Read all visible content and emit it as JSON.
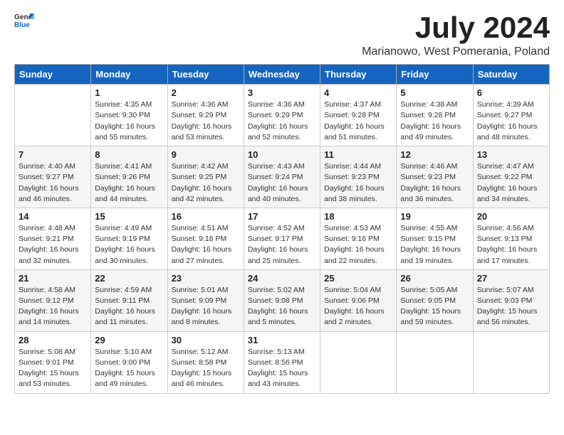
{
  "header": {
    "logo_general": "General",
    "logo_blue": "Blue",
    "month_title": "July 2024",
    "subtitle": "Marianowo, West Pomerania, Poland"
  },
  "days_of_week": [
    "Sunday",
    "Monday",
    "Tuesday",
    "Wednesday",
    "Thursday",
    "Friday",
    "Saturday"
  ],
  "weeks": [
    [
      {
        "day": "",
        "info": ""
      },
      {
        "day": "1",
        "info": "Sunrise: 4:35 AM\nSunset: 9:30 PM\nDaylight: 16 hours\nand 55 minutes."
      },
      {
        "day": "2",
        "info": "Sunrise: 4:36 AM\nSunset: 9:29 PM\nDaylight: 16 hours\nand 53 minutes."
      },
      {
        "day": "3",
        "info": "Sunrise: 4:36 AM\nSunset: 9:29 PM\nDaylight: 16 hours\nand 52 minutes."
      },
      {
        "day": "4",
        "info": "Sunrise: 4:37 AM\nSunset: 9:28 PM\nDaylight: 16 hours\nand 51 minutes."
      },
      {
        "day": "5",
        "info": "Sunrise: 4:38 AM\nSunset: 9:28 PM\nDaylight: 16 hours\nand 49 minutes."
      },
      {
        "day": "6",
        "info": "Sunrise: 4:39 AM\nSunset: 9:27 PM\nDaylight: 16 hours\nand 48 minutes."
      }
    ],
    [
      {
        "day": "7",
        "info": "Sunrise: 4:40 AM\nSunset: 9:27 PM\nDaylight: 16 hours\nand 46 minutes."
      },
      {
        "day": "8",
        "info": "Sunrise: 4:41 AM\nSunset: 9:26 PM\nDaylight: 16 hours\nand 44 minutes."
      },
      {
        "day": "9",
        "info": "Sunrise: 4:42 AM\nSunset: 9:25 PM\nDaylight: 16 hours\nand 42 minutes."
      },
      {
        "day": "10",
        "info": "Sunrise: 4:43 AM\nSunset: 9:24 PM\nDaylight: 16 hours\nand 40 minutes."
      },
      {
        "day": "11",
        "info": "Sunrise: 4:44 AM\nSunset: 9:23 PM\nDaylight: 16 hours\nand 38 minutes."
      },
      {
        "day": "12",
        "info": "Sunrise: 4:46 AM\nSunset: 9:23 PM\nDaylight: 16 hours\nand 36 minutes."
      },
      {
        "day": "13",
        "info": "Sunrise: 4:47 AM\nSunset: 9:22 PM\nDaylight: 16 hours\nand 34 minutes."
      }
    ],
    [
      {
        "day": "14",
        "info": "Sunrise: 4:48 AM\nSunset: 9:21 PM\nDaylight: 16 hours\nand 32 minutes."
      },
      {
        "day": "15",
        "info": "Sunrise: 4:49 AM\nSunset: 9:19 PM\nDaylight: 16 hours\nand 30 minutes."
      },
      {
        "day": "16",
        "info": "Sunrise: 4:51 AM\nSunset: 9:18 PM\nDaylight: 16 hours\nand 27 minutes."
      },
      {
        "day": "17",
        "info": "Sunrise: 4:52 AM\nSunset: 9:17 PM\nDaylight: 16 hours\nand 25 minutes."
      },
      {
        "day": "18",
        "info": "Sunrise: 4:53 AM\nSunset: 9:16 PM\nDaylight: 16 hours\nand 22 minutes."
      },
      {
        "day": "19",
        "info": "Sunrise: 4:55 AM\nSunset: 9:15 PM\nDaylight: 16 hours\nand 19 minutes."
      },
      {
        "day": "20",
        "info": "Sunrise: 4:56 AM\nSunset: 9:13 PM\nDaylight: 16 hours\nand 17 minutes."
      }
    ],
    [
      {
        "day": "21",
        "info": "Sunrise: 4:58 AM\nSunset: 9:12 PM\nDaylight: 16 hours\nand 14 minutes."
      },
      {
        "day": "22",
        "info": "Sunrise: 4:59 AM\nSunset: 9:11 PM\nDaylight: 16 hours\nand 11 minutes."
      },
      {
        "day": "23",
        "info": "Sunrise: 5:01 AM\nSunset: 9:09 PM\nDaylight: 16 hours\nand 8 minutes."
      },
      {
        "day": "24",
        "info": "Sunrise: 5:02 AM\nSunset: 9:08 PM\nDaylight: 16 hours\nand 5 minutes."
      },
      {
        "day": "25",
        "info": "Sunrise: 5:04 AM\nSunset: 9:06 PM\nDaylight: 16 hours\nand 2 minutes."
      },
      {
        "day": "26",
        "info": "Sunrise: 5:05 AM\nSunset: 9:05 PM\nDaylight: 15 hours\nand 59 minutes."
      },
      {
        "day": "27",
        "info": "Sunrise: 5:07 AM\nSunset: 9:03 PM\nDaylight: 15 hours\nand 56 minutes."
      }
    ],
    [
      {
        "day": "28",
        "info": "Sunrise: 5:08 AM\nSunset: 9:01 PM\nDaylight: 15 hours\nand 53 minutes."
      },
      {
        "day": "29",
        "info": "Sunrise: 5:10 AM\nSunset: 9:00 PM\nDaylight: 15 hours\nand 49 minutes."
      },
      {
        "day": "30",
        "info": "Sunrise: 5:12 AM\nSunset: 8:58 PM\nDaylight: 15 hours\nand 46 minutes."
      },
      {
        "day": "31",
        "info": "Sunrise: 5:13 AM\nSunset: 8:56 PM\nDaylight: 15 hours\nand 43 minutes."
      },
      {
        "day": "",
        "info": ""
      },
      {
        "day": "",
        "info": ""
      },
      {
        "day": "",
        "info": ""
      }
    ]
  ]
}
